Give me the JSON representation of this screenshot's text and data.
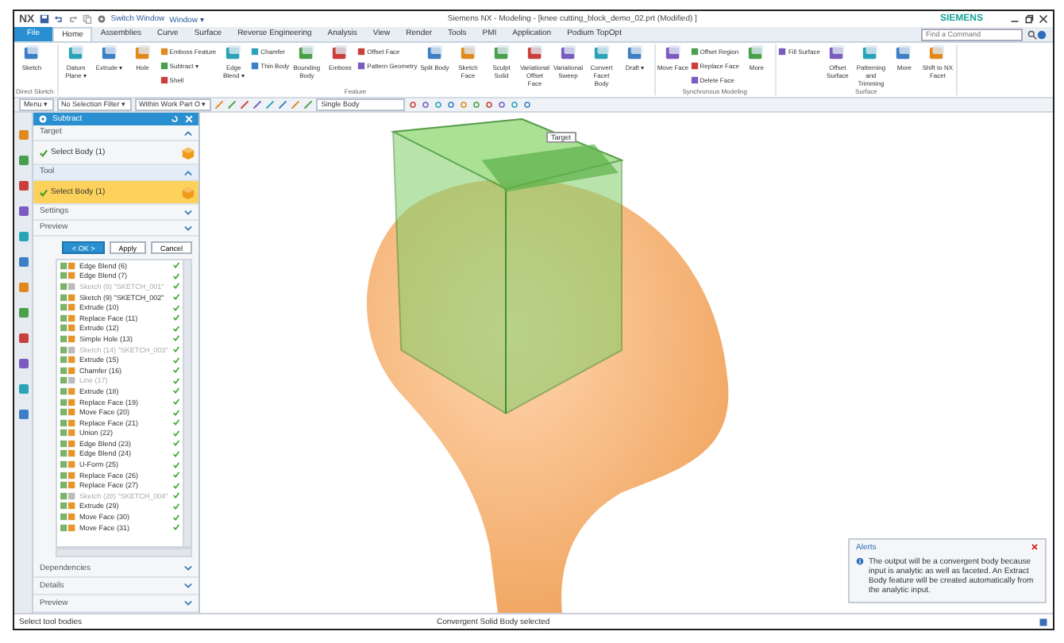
{
  "window": {
    "logo": "NX",
    "switch_window": "Switch Window",
    "window_menu": "Window ▾",
    "title": "Siemens NX - Modeling - [knee cutting_block_demo_02.prt (Modified) ]",
    "brand": "SIEMENS"
  },
  "menu_tabs": [
    {
      "label": "File",
      "selected": false,
      "kind": "file"
    },
    {
      "label": "Home",
      "selected": true,
      "kind": "tab"
    },
    {
      "label": "Assemblies",
      "selected": false,
      "kind": "tab"
    },
    {
      "label": "Curve",
      "selected": false,
      "kind": "tab"
    },
    {
      "label": "Surface",
      "selected": false,
      "kind": "tab"
    },
    {
      "label": "Reverse Engineering",
      "selected": false,
      "kind": "tab"
    },
    {
      "label": "Analysis",
      "selected": false,
      "kind": "tab"
    },
    {
      "label": "View",
      "selected": false,
      "kind": "tab"
    },
    {
      "label": "Render",
      "selected": false,
      "kind": "tab"
    },
    {
      "label": "Tools",
      "selected": false,
      "kind": "tab"
    },
    {
      "label": "PMI",
      "selected": false,
      "kind": "tab"
    },
    {
      "label": "Application",
      "selected": false,
      "kind": "tab"
    },
    {
      "label": "Podium TopOpt",
      "selected": false,
      "kind": "tab"
    }
  ],
  "command_search": {
    "placeholder": "Find a Command"
  },
  "ribbon_groups": [
    {
      "label": "Direct Sketch",
      "commands": [
        {
          "label": "Sketch",
          "kind": "large"
        }
      ]
    },
    {
      "label": "Feature",
      "commands": [
        {
          "label": "Datum Plane ▾",
          "kind": "large"
        },
        {
          "label": "Extrude ▾",
          "kind": "large"
        },
        {
          "label": "Hole",
          "kind": "large"
        },
        {
          "label": "Emboss Feature",
          "kind": "small"
        },
        {
          "label": "Subtract ▾",
          "kind": "small"
        },
        {
          "label": "Shell",
          "kind": "small"
        },
        {
          "label": "Edge Blend ▾",
          "kind": "large"
        },
        {
          "label": "Chamfer",
          "kind": "small"
        },
        {
          "label": "Thin Body",
          "kind": "small"
        },
        {
          "label": "Bounding Body",
          "kind": "large"
        },
        {
          "label": "Emboss",
          "kind": "large"
        },
        {
          "label": "Offset Face",
          "kind": "small"
        },
        {
          "label": "Pattern Geometry",
          "kind": "small"
        },
        {
          "label": "Split Body",
          "kind": "large"
        },
        {
          "label": "Sketch Face",
          "kind": "large"
        },
        {
          "label": "Sculpt Solid",
          "kind": "large"
        },
        {
          "label": "Variational Offset Face",
          "kind": "large"
        },
        {
          "label": "Variational Sweep",
          "kind": "large"
        },
        {
          "label": "Convert Facet Body",
          "kind": "large"
        },
        {
          "label": "Draft ▾",
          "kind": "large"
        }
      ]
    },
    {
      "label": "Synchronous Modeling",
      "commands": [
        {
          "label": "Move Face",
          "kind": "large"
        },
        {
          "label": "Offset Region",
          "kind": "small"
        },
        {
          "label": "Replace Face",
          "kind": "small"
        },
        {
          "label": "Delete Face",
          "kind": "small"
        },
        {
          "label": "More",
          "kind": "large"
        }
      ]
    },
    {
      "label": "Surface",
      "commands": [
        {
          "label": "Fill Surface",
          "kind": "small"
        },
        {
          "label": "Offset Surface",
          "kind": "large"
        },
        {
          "label": "Patterning and Trimming",
          "kind": "large"
        },
        {
          "label": "More",
          "kind": "large"
        },
        {
          "label": "Shift to NX Facet",
          "kind": "large"
        }
      ]
    }
  ],
  "selection_bar": {
    "menu": "Menu ▾",
    "filter": "No Selection Filter ▾",
    "scope": "Within Work Part O ▾",
    "body_rule": "Single Body"
  },
  "dialog": {
    "title": "Subtract",
    "sections": [
      {
        "label": "Target",
        "expanded": true,
        "selected": false,
        "selection": "Select Body (1)"
      },
      {
        "label": "Tool",
        "expanded": true,
        "selected": true,
        "selection": "Select Body (1)"
      },
      {
        "label": "Settings",
        "expanded": false,
        "selected": false
      },
      {
        "label": "Preview",
        "expanded": false,
        "selected": false
      }
    ],
    "buttons": [
      {
        "label": "< OK >",
        "kind": "primary"
      },
      {
        "label": "Apply",
        "kind": "normal"
      },
      {
        "label": "Cancel",
        "kind": "normal"
      }
    ],
    "features": [
      {
        "label": "Edge Blend (6)",
        "disabled": false,
        "checked": true
      },
      {
        "label": "Edge Blend (7)",
        "disabled": false,
        "checked": true
      },
      {
        "label": "Sketch (8) \"SKETCH_001\"",
        "disabled": true,
        "checked": true
      },
      {
        "label": "Sketch (9) \"SKETCH_002\"",
        "disabled": false,
        "checked": true
      },
      {
        "label": "Extrude (10)",
        "disabled": false,
        "checked": true
      },
      {
        "label": "Replace Face (11)",
        "disabled": false,
        "checked": true
      },
      {
        "label": "Extrude (12)",
        "disabled": false,
        "checked": true
      },
      {
        "label": "Simple Hole (13)",
        "disabled": false,
        "checked": true
      },
      {
        "label": "Sketch (14) \"SKETCH_003\"",
        "disabled": true,
        "checked": true
      },
      {
        "label": "Extrude (15)",
        "disabled": false,
        "checked": true
      },
      {
        "label": "Chamfer (16)",
        "disabled": false,
        "checked": true
      },
      {
        "label": "Line (17)",
        "disabled": true,
        "checked": true
      },
      {
        "label": "Extrude (18)",
        "disabled": false,
        "checked": true
      },
      {
        "label": "Replace Face (19)",
        "disabled": false,
        "checked": true
      },
      {
        "label": "Move Face (20)",
        "disabled": false,
        "checked": true
      },
      {
        "label": "Replace Face (21)",
        "disabled": false,
        "checked": true
      },
      {
        "label": "Union (22)",
        "disabled": false,
        "checked": true
      },
      {
        "label": "Edge Blend (23)",
        "disabled": false,
        "checked": true
      },
      {
        "label": "Edge Blend (24)",
        "disabled": false,
        "checked": true
      },
      {
        "label": "U-Form (25)",
        "disabled": false,
        "checked": true
      },
      {
        "label": "Replace Face (26)",
        "disabled": false,
        "checked": true
      },
      {
        "label": "Replace Face (27)",
        "disabled": false,
        "checked": true
      },
      {
        "label": "Sketch (28) \"SKETCH_004\"",
        "disabled": true,
        "checked": true
      },
      {
        "label": "Extrude (29)",
        "disabled": false,
        "checked": true
      },
      {
        "label": "Move Face (30)",
        "disabled": false,
        "checked": true
      },
      {
        "label": "Move Face (31)",
        "disabled": false,
        "checked": true
      }
    ],
    "lower_sections": [
      {
        "label": "Dependencies",
        "expanded": false
      },
      {
        "label": "Details",
        "expanded": false
      },
      {
        "label": "Preview",
        "expanded": false
      }
    ]
  },
  "viewport": {
    "target_label": "Target"
  },
  "alert": {
    "title": "Alerts",
    "message": "The output will be a convergent body because input is analytic as well as faceted. An Extract Body feature will be created automatically from the analytic input."
  },
  "status_bar": {
    "prompt": "Select tool bodies",
    "message": "Convergent Solid Body selected"
  }
}
